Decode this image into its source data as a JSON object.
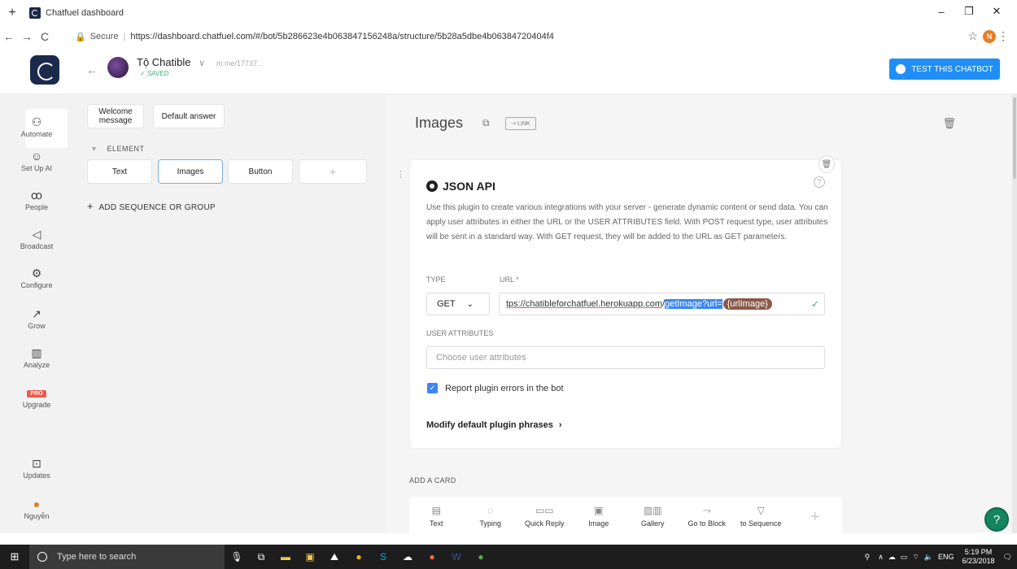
{
  "browser": {
    "tab_title": "Chatfuel dashboard",
    "secure_label": "Secure",
    "url": "https://dashboard.chatfuel.com/#/bot/5b286623e4b063847156248a/structure/5b28a5dbe4b06384720404f4",
    "profile_initial": "N"
  },
  "appbar": {
    "bot_name": "Tộ Chatible",
    "bot_link": "m.me/17737...",
    "saved_label": "SAVED",
    "test_button": "TEST THIS CHATBOT"
  },
  "rail": {
    "items": [
      {
        "label": "Automate",
        "icon": "automate-icon"
      },
      {
        "label": "Set Up AI",
        "icon": "ai-icon"
      },
      {
        "label": "People",
        "icon": "people-icon"
      },
      {
        "label": "Broadcast",
        "icon": "megaphone-icon"
      },
      {
        "label": "Configure",
        "icon": "gear-icon"
      },
      {
        "label": "Grow",
        "icon": "grow-icon"
      },
      {
        "label": "Analyze",
        "icon": "chart-icon"
      },
      {
        "label": "Upgrade",
        "icon": "pro-badge",
        "badge": "PRO"
      },
      {
        "label": "Updates",
        "icon": "updates-icon"
      },
      {
        "label": "Nguyễn",
        "icon": "user-avatar"
      }
    ]
  },
  "structure": {
    "welcome": "Welcome message",
    "default_answer": "Default answer",
    "element_label": "ELEMENT",
    "blocks": [
      "Text",
      "Images",
      "Button"
    ],
    "add_sequence": "ADD SEQUENCE OR GROUP"
  },
  "editor": {
    "title": "Images",
    "link_label": "LINK",
    "plugin_title": "JSON API",
    "description": "Use this plugin to create various integrations with your server - generate dynamic content or send data. You can apply user attributes in either the URL or the USER ATTRIBUTES field. With POST request type, user attributes will be sent in a standard way. With GET request, they will be added to the URL as GET parameters.",
    "type_label": "TYPE",
    "url_label": "URL",
    "type_value": "GET",
    "url_plain_1": "tps://",
    "url_plain_2": "chatibleforchatfuel.herokuapp.com",
    "url_plain_3": "/",
    "url_highlight": "getImage?url=",
    "url_attr": "{urlImage}",
    "user_attributes_label": "USER ATTRIBUTES",
    "user_attributes_placeholder": "Choose user attributes",
    "report_errors_label": "Report plugin errors in the bot",
    "report_errors_checked": true,
    "modify_phrases": "Modify default plugin phrases",
    "add_card_label": "ADD A CARD",
    "tools": [
      {
        "label": "Text",
        "icon": "text-icon"
      },
      {
        "label": "Typing",
        "icon": "typing-icon"
      },
      {
        "label": "Quick Reply",
        "icon": "quick-reply-icon"
      },
      {
        "label": "Image",
        "icon": "image-icon"
      },
      {
        "label": "Gallery",
        "icon": "gallery-icon"
      },
      {
        "label": "Go to Block",
        "icon": "goto-block-icon"
      },
      {
        "label": "to Sequence",
        "icon": "filter-icon"
      }
    ]
  },
  "taskbar": {
    "search_placeholder": "Type here to search",
    "lang": "ENG",
    "time": "5:19 PM",
    "date": "6/23/2018"
  }
}
